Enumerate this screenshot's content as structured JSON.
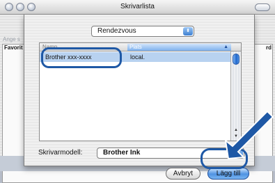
{
  "window": {
    "title": "Skrivarlista"
  },
  "background": {
    "side_label_1": "Ange s",
    "header_left": "Favorit",
    "header_right": "rd"
  },
  "sheet": {
    "connection_popup": "Rendezvous",
    "list": {
      "columns": [
        "Namn",
        "Plats"
      ],
      "rows": [
        {
          "name": "Brother  xxx-xxxx",
          "location": "local."
        }
      ]
    },
    "model_label": "Skrivarmodell:",
    "model_value": "Brother Ink",
    "cancel_label": "Avbryt",
    "add_label": "Lägg till"
  },
  "colors": {
    "highlight": "#1e58a5",
    "selection": "#b8d2f0",
    "aqua_button": "#4f93e3"
  },
  "icons": [
    "close-traffic-icon",
    "minimize-traffic-icon",
    "zoom-traffic-icon",
    "toolbar-toggle-icon",
    "popup-arrow-icon",
    "sort-arrow-icon",
    "scroll-up-icon",
    "scroll-down-icon",
    "pointer-arrow-icon"
  ]
}
